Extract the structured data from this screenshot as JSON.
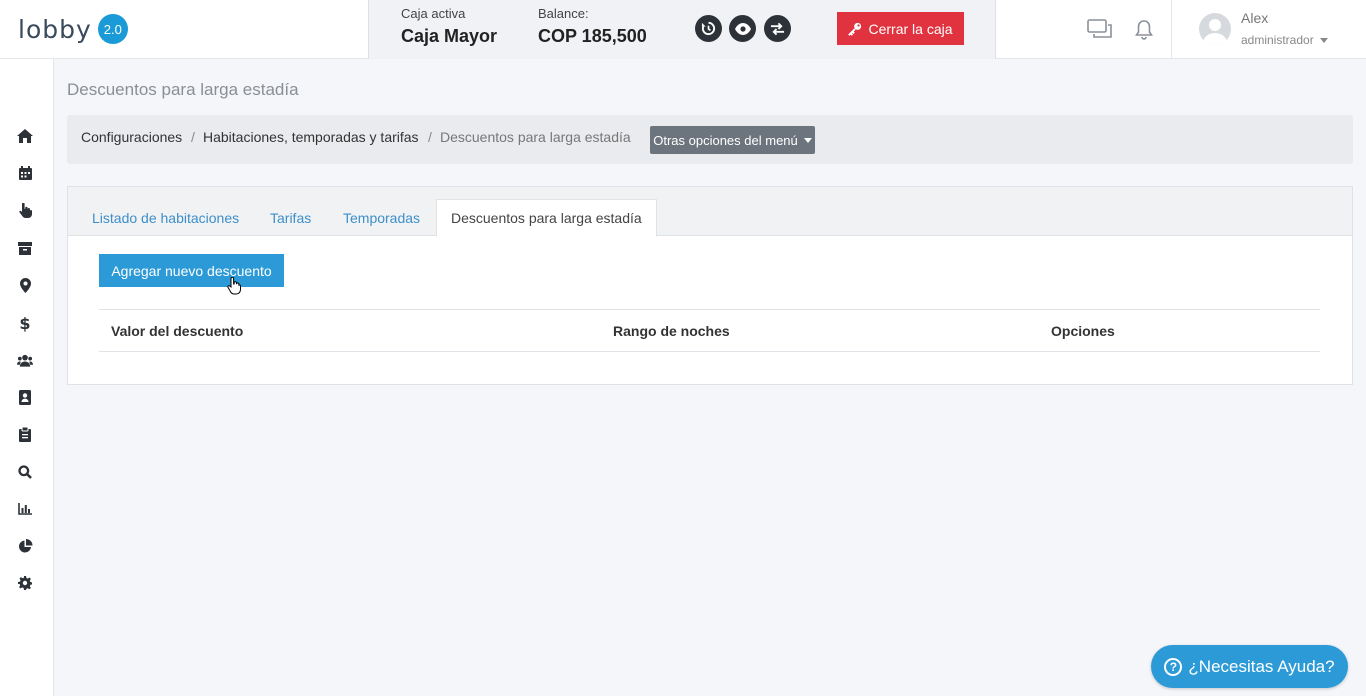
{
  "app": {
    "logo_text": "lobby",
    "logo_version": "2.0"
  },
  "caja": {
    "active_label": "Caja activa",
    "active_value": "Caja Mayor",
    "balance_label": "Balance:",
    "balance_value": "COP 185,500",
    "close_label": "Cerrar la caja"
  },
  "user": {
    "name": "Alex",
    "role": "administrador"
  },
  "sidebar": {
    "items": [
      {
        "icon": "home-icon"
      },
      {
        "icon": "calendar-icon"
      },
      {
        "icon": "hand-pointer-icon"
      },
      {
        "icon": "archive-icon"
      },
      {
        "icon": "map-marker-icon"
      },
      {
        "icon": "dollar-icon"
      },
      {
        "icon": "users-icon"
      },
      {
        "icon": "contact-book-icon"
      },
      {
        "icon": "clipboard-icon"
      },
      {
        "icon": "search-icon"
      },
      {
        "icon": "bar-chart-icon"
      },
      {
        "icon": "pie-chart-icon"
      },
      {
        "icon": "gear-icon"
      }
    ]
  },
  "page": {
    "title": "Descuentos para larga estadía"
  },
  "breadcrumb": {
    "items": [
      "Configuraciones",
      "Habitaciones, temporadas y tarifas",
      "Descuentos para larga estadía"
    ],
    "separator": "/",
    "menu_label": "Otras opciones del menú"
  },
  "tabs": [
    {
      "label": "Listado de habitaciones",
      "active": false
    },
    {
      "label": "Tarifas",
      "active": false
    },
    {
      "label": "Temporadas",
      "active": false
    },
    {
      "label": "Descuentos para larga estadía",
      "active": true
    }
  ],
  "content": {
    "add_button": "Agregar nuevo descuento",
    "columns": [
      "Valor del descuento",
      "Rango de noches",
      "Opciones"
    ]
  },
  "help": {
    "label": "¿Necesitas Ayuda?",
    "icon_glyph": "?"
  },
  "colors": {
    "brand_blue": "#2b9ad7",
    "danger_red": "#e0333f",
    "dark": "#2d3238"
  }
}
